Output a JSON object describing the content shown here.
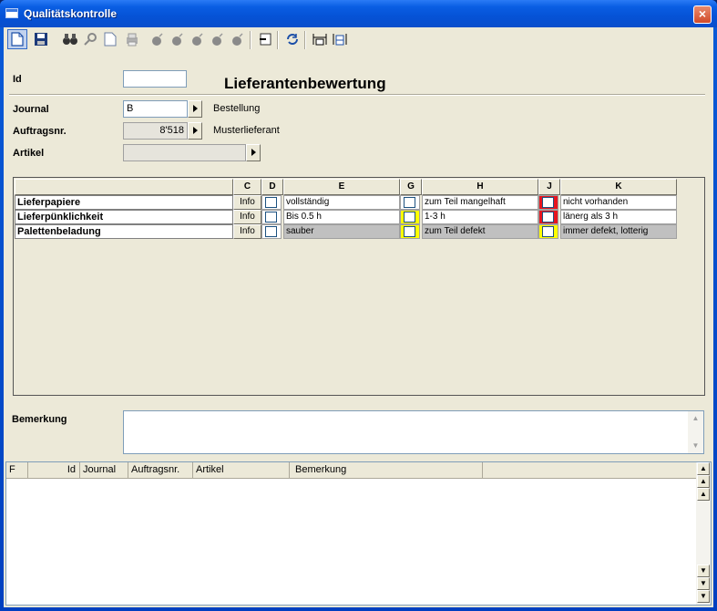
{
  "window": {
    "title": "Qualitätskontrolle",
    "close_label": "×"
  },
  "toolbar": {
    "buttons": [
      "new-doc-icon",
      "save-icon",
      "find-icon",
      "lookup-icon",
      "blank-doc-icon",
      "print-icon",
      "bomb-icon",
      "bomb-icon",
      "bomb-icon",
      "bomb-icon",
      "bomb-icon",
      "exit-icon",
      "refresh-icon",
      "fit-width-icon",
      "fit-page-icon"
    ]
  },
  "form": {
    "id_label": "Id",
    "id_value": "",
    "heading": "Lieferantenbewertung",
    "journal_label": "Journal",
    "journal_value": "B",
    "journal_desc": "Bestellung",
    "auftrag_label": "Auftragsnr.",
    "auftrag_value": "8'518",
    "auftrag_desc": "Musterlieferant",
    "artikel_label": "Artikel",
    "artikel_value": ""
  },
  "grid": {
    "headers": {
      "c": "C",
      "d": "D",
      "e": "E",
      "g": "G",
      "h": "H",
      "j": "J",
      "k": "K"
    },
    "rows": [
      {
        "label": "Lieferpapiere",
        "info": "Info",
        "e": "vollständig",
        "h": "zum Teil mangelhaft",
        "k": "nicht vorhanden",
        "g_color": "#ffffff",
        "j_color": "#e8141e",
        "grey": false
      },
      {
        "label": "Lieferpünklichkeit",
        "info": "Info",
        "e": "Bis 0.5 h",
        "h": "1-3 h",
        "k": "länerg als 3 h",
        "g_color": "#ffff00",
        "j_color": "#e8141e",
        "grey": false
      },
      {
        "label": "Palettenbeladung",
        "info": "Info",
        "e": "sauber",
        "h": "zum Teil defekt",
        "k": "immer defekt, lotterig",
        "g_color": "#ffff00",
        "j_color": "#ffff00",
        "grey": true
      }
    ]
  },
  "bemerkung": {
    "label": "Bemerkung",
    "value": ""
  },
  "list": {
    "columns": [
      "F",
      "Id",
      "Journal",
      "Auftragsnr.",
      "Artikel",
      "Bemerkung"
    ]
  }
}
